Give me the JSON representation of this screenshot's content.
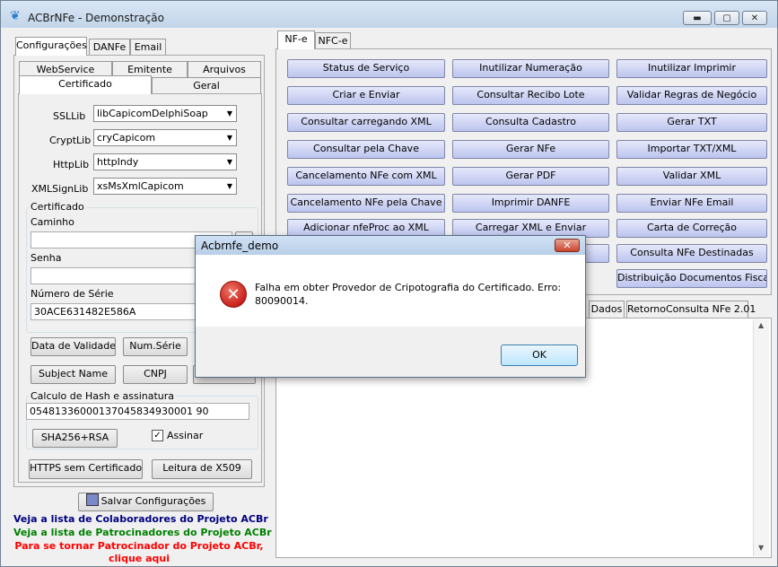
{
  "window": {
    "title": "ACBrNFe - Demonstração",
    "minimize": "▬",
    "maximize": "▢",
    "close": "✕"
  },
  "left_tabs": [
    "Configurações",
    "DANFe",
    "Email"
  ],
  "config_tabs_row1": [
    "WebService",
    "Emitente",
    "Arquivos"
  ],
  "config_tabs_row2": [
    "Certificado",
    "Geral"
  ],
  "certificado": {
    "ssllib_label": "SSLLib",
    "ssllib_value": "libCapicomDelphiSoap",
    "cryptlib_label": "CryptLib",
    "cryptlib_value": "cryCapicom",
    "httplib_label": "HttpLib",
    "httplib_value": "httpIndy",
    "xmlsignlib_label": "XMLSignLib",
    "xmlsignlib_value": "xsMsXmlCapicom",
    "group_label": "Certificado",
    "caminho_label": "Caminho",
    "caminho_value": "",
    "senha_label": "Senha",
    "senha_value": "",
    "numero_serie_label": "Número de Série",
    "numero_serie_value": "30ACE631482E586A",
    "btn_data_validade": "Data de Validade",
    "btn_num_serie": "Num.Série",
    "btn_subject_name": "Subject Name",
    "btn_cnpj": "CNPJ",
    "hash_group_label": "Calculo de Hash e assinatura",
    "hash_value": "05481336000137045834930001 90",
    "btn_sha256": "SHA256+RSA",
    "assinar_label": "Assinar",
    "btn_https": "HTTPS sem Certificado",
    "btn_leitura_x509": "Leitura de X509"
  },
  "salvar_button": "Salvar Configurações",
  "links": {
    "colaboradores": "Veja a lista de Colaboradores do Projeto ACBr",
    "patrocinadores": "Veja a lista de Patrocinadores do Projeto ACBr",
    "tornar_patrocinador": "Para se tornar Patrocinador do Projeto ACBr,",
    "clique_aqui": "clique aqui"
  },
  "right_tabs": [
    "NF-e",
    "NFC-e"
  ],
  "nfe_buttons": [
    [
      "Status de Serviço",
      "Inutilizar Numeração",
      "Inutilizar Imprimir"
    ],
    [
      "Criar e Enviar",
      "Consultar Recibo Lote",
      "Validar Regras de Negócio"
    ],
    [
      "Consultar carregando XML",
      "Consulta Cadastro",
      "Gerar TXT"
    ],
    [
      "Consultar pela Chave",
      "Gerar NFe",
      "Importar TXT/XML"
    ],
    [
      "Cancelamento NFe com XML",
      "Gerar PDF",
      "Validar XML"
    ],
    [
      "Cancelamento NFe pela Chave",
      "Imprimir DANFE",
      "Enviar NFe Email"
    ],
    [
      "Adicionar nfeProc ao XML",
      "Carregar XML e Enviar",
      "Carta de Correção"
    ],
    [
      "",
      "ão",
      "Consulta NFe Destinadas"
    ],
    [
      "",
      "",
      "Distribuição Documentos Fiscais"
    ]
  ],
  "lower_tabs": [
    "Dados",
    "RetornoConsulta NFe 2.01"
  ],
  "dialog": {
    "title": "Acbrnfe_demo",
    "close": "✕",
    "message": "Falha em obter Provedor de Cripotografia do Certificado. Erro: 80090014.",
    "ok_button": "OK"
  },
  "colors": {
    "button_blue": "#c8cef2",
    "link_blue": "#000080",
    "link_green": "#008000",
    "link_red": "#ff0000"
  }
}
